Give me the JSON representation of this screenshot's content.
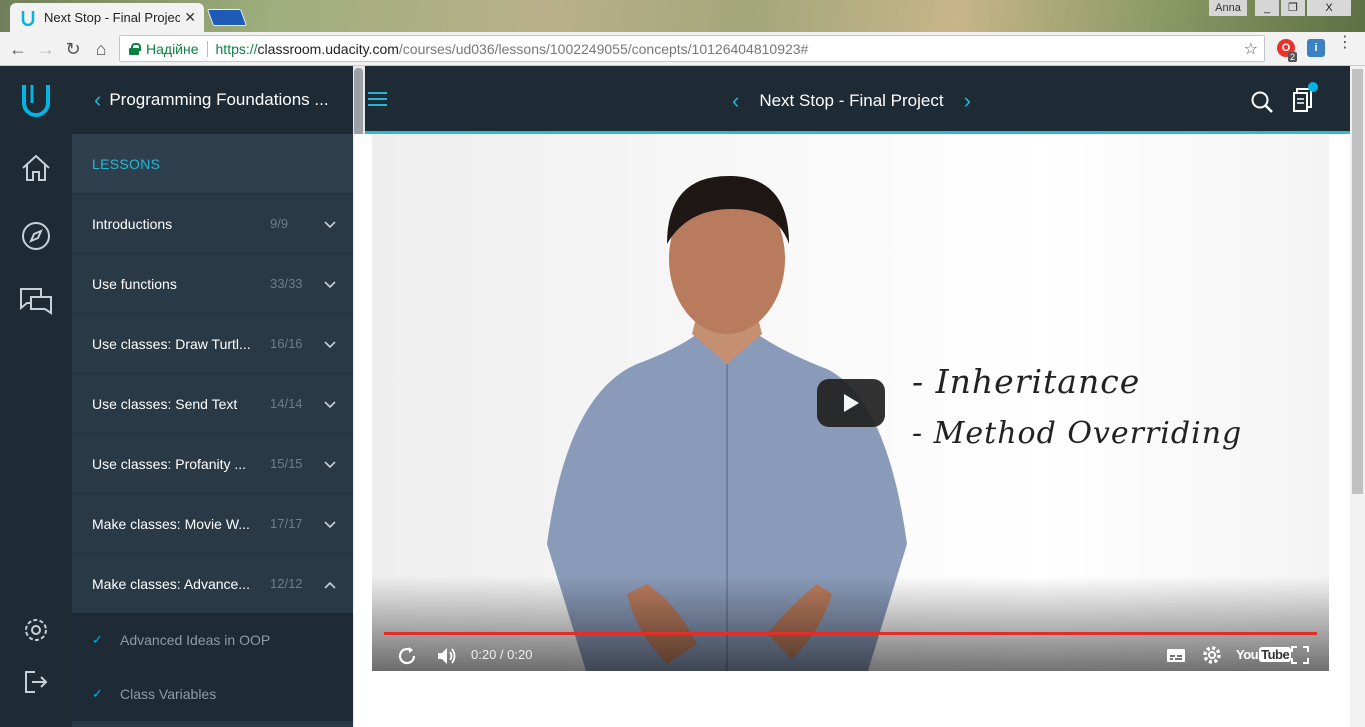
{
  "browser": {
    "tab_title": "Next Stop - Final Project",
    "tab_close": "✕",
    "user_name": "Anna",
    "window_minimize": "_",
    "window_restore": "❐",
    "window_close": "X",
    "secure_label": "Надійне",
    "url_scheme": "https://",
    "url_host": "classroom.udacity.com",
    "url_path": "/courses/ud036/lessons/1002249055/concepts/10126404810923#",
    "extension_badge": "2",
    "extension_letter": "i"
  },
  "course": {
    "title": "Programming Foundations ...",
    "lessons_header": "LESSONS",
    "lessons": [
      {
        "title": "Introductions",
        "count": "9/9",
        "expanded": false
      },
      {
        "title": "Use functions",
        "count": "33/33",
        "expanded": false
      },
      {
        "title": "Use classes: Draw Turtl...",
        "count": "16/16",
        "expanded": false
      },
      {
        "title": "Use classes: Send Text",
        "count": "14/14",
        "expanded": false
      },
      {
        "title": "Use classes: Profanity ...",
        "count": "15/15",
        "expanded": false
      },
      {
        "title": "Make classes: Movie W...",
        "count": "17/17",
        "expanded": false
      },
      {
        "title": "Make classes: Advance...",
        "count": "12/12",
        "expanded": true
      }
    ],
    "concepts": [
      {
        "title": "Advanced Ideas in OOP",
        "done": true
      },
      {
        "title": "Class Variables",
        "done": true
      }
    ],
    "check_mark": "✓"
  },
  "header": {
    "concept_title": "Next Stop - Final Project"
  },
  "video": {
    "slide_lines": [
      "- Inheritance",
      "- Method   Overriding"
    ],
    "time_current": "0:20",
    "time_sep": " / ",
    "time_total": "0:20",
    "progress": 1.0,
    "yt_you": "You",
    "yt_tube": "Tube"
  },
  "colors": {
    "accent": "#02b3e4",
    "rail_bg": "#1e2a34",
    "sidebar_bg": "#2a3946",
    "progress_red": "#e52d27"
  }
}
